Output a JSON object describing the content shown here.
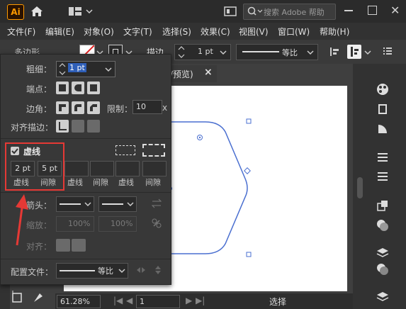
{
  "app": {
    "logo": "Ai"
  },
  "search": {
    "placeholder": "搜索 Adobe 帮助"
  },
  "menu": [
    "文件(F)",
    "编辑(E)",
    "对象(O)",
    "文字(T)",
    "选择(S)",
    "效果(C)",
    "视图(V)",
    "窗口(W)",
    "帮助(H)"
  ],
  "control": {
    "tool_name": "多边形",
    "stroke_label": "描边",
    "stroke_value": "1 pt",
    "profile": "等比"
  },
  "doc_tab": {
    "label": "/预览)",
    "close": "×"
  },
  "stroke_panel": {
    "weight_label": "粗细",
    "weight_value": "1 pt",
    "cap_label": "端点",
    "corner_label": "边角",
    "limit_label": "限制",
    "limit_value": "10",
    "limit_unit": "x",
    "align_label": "对齐描边",
    "dashed_label": "虚线",
    "dashed_checked": true,
    "dash_values": [
      "2 pt",
      "5 pt",
      "",
      "",
      "",
      ""
    ],
    "dash_labels": [
      "虚线",
      "间隙",
      "虚线",
      "间隙",
      "虚线",
      "间隙"
    ],
    "arrow_label": "箭头",
    "scale_label": "缩放",
    "scale_values": [
      "100%",
      "100%"
    ],
    "arrow_align_label": "对齐",
    "profile_label": "配置文件",
    "profile_value": "等比"
  },
  "status": {
    "zoom": "61.28%",
    "page": "1",
    "tool": "选择"
  },
  "highlight_color": "#e53935",
  "accent_color": "#3b73d6"
}
